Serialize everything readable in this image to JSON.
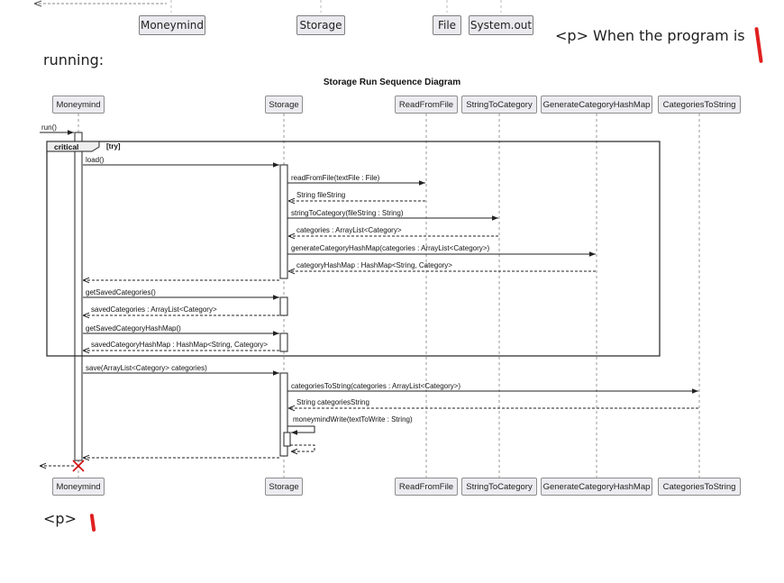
{
  "preview": {
    "participants": [
      "Moneymind",
      "Storage",
      "File",
      "System.out"
    ],
    "text_right": "<p> When the program is",
    "text_left": "running:"
  },
  "diagram": {
    "title": "Storage Run Sequence Diagram",
    "participants": [
      "Moneymind",
      "Storage",
      "ReadFromFile",
      "StringToCategory",
      "GenerateCategoryHashMap",
      "CategoriesToString"
    ],
    "fragment_label": "critical",
    "fragment_guard": "[try]",
    "messages": {
      "run": "run()",
      "load": "load()",
      "read_from_file": "readFromFile(textFile : File)",
      "file_string": "String fileString",
      "string_to_category": "stringToCategory(fileString : String)",
      "categories_return": "categories : ArrayList<Category>",
      "generate_hashmap": "generateCategoryHashMap(categories : ArrayList<Category>)",
      "hashmap_return": "categoryHashMap : HashMap<String, Category>",
      "get_saved_categories": "getSavedCategories()",
      "saved_categories": "savedCategories : ArrayList<Category>",
      "get_saved_hashmap": "getSavedCategoryHashMap()",
      "saved_hashmap": "savedCategoryHashMap : HashMap<String, Category>",
      "save": "save(ArrayList<Category> categories)",
      "categories_to_string": "categoriesToString(categories : ArrayList<Category>)",
      "categories_string": "String categoriesString",
      "moneymind_write": "moneymindWrite(textToWrite : String)"
    }
  },
  "footer_text": "<p>",
  "colors": {
    "cursor": "#e02020",
    "box_fill": "#ececf0"
  }
}
